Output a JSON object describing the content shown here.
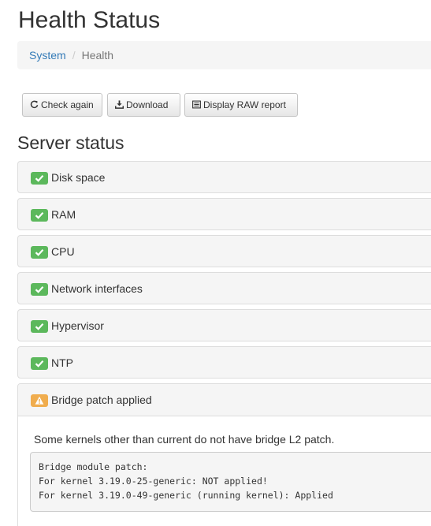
{
  "page": {
    "title": "Health Status"
  },
  "breadcrumb": {
    "items": [
      {
        "label": "System"
      },
      {
        "label": "Health"
      }
    ],
    "separator": "/"
  },
  "toolbar": {
    "check_again_label": "Check again",
    "download_label": "Download",
    "raw_report_label": "Display RAW report"
  },
  "server_status": {
    "heading": "Server status",
    "checks": [
      {
        "label": "Disk space",
        "status": "ok",
        "icon": "check-icon"
      },
      {
        "label": "RAM",
        "status": "ok",
        "icon": "check-icon"
      },
      {
        "label": "CPU",
        "status": "ok",
        "icon": "check-icon"
      },
      {
        "label": "Network interfaces",
        "status": "ok",
        "icon": "check-icon"
      },
      {
        "label": "Hypervisor",
        "status": "ok",
        "icon": "check-icon"
      },
      {
        "label": "NTP",
        "status": "ok",
        "icon": "check-icon"
      },
      {
        "label": "Bridge patch applied",
        "status": "warning",
        "icon": "warning-icon",
        "message": "Some kernels other than current do not have bridge L2 patch.",
        "details": "Bridge module patch:\nFor kernel 3.19.0-25-generic: NOT applied!\nFor kernel 3.19.0-49-generic (running kernel): Applied"
      }
    ]
  },
  "colors": {
    "ok": "#5cb85c",
    "warning": "#f0ad4e",
    "link": "#337ab7"
  }
}
